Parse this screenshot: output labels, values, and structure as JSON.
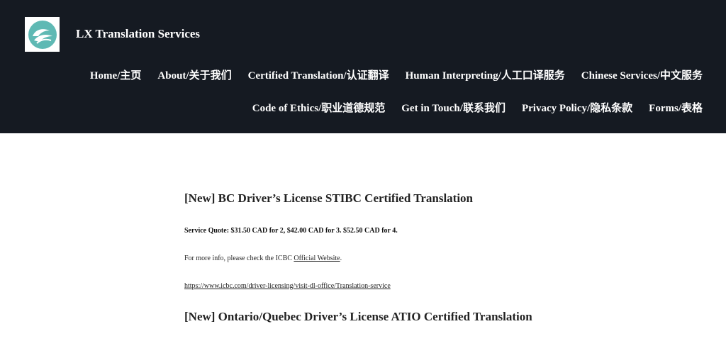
{
  "site": {
    "title": "LX Translation Services",
    "logo_icon": "wave-hands-icon",
    "colors": {
      "header_bg": "#151a22",
      "logo_teal": "#5fb9b4"
    }
  },
  "nav": {
    "row1": [
      {
        "label": "Home/主页"
      },
      {
        "label": "About/关于我们"
      },
      {
        "label": "Certified Translation/认证翻译"
      },
      {
        "label": "Human Interpreting/人工口译服务"
      },
      {
        "label": "Chinese Services/中文服务"
      }
    ],
    "row2": [
      {
        "label": "Code of Ethics/职业道德规范"
      },
      {
        "label": "Get in Touch/联系我们"
      },
      {
        "label": "Privacy Policy/隐私条款"
      },
      {
        "label": "Forms/表格"
      }
    ]
  },
  "content": {
    "heading1": "[New] BC Driver’s License STIBC Certified Translation",
    "quote": "Service Quote: $31.50 CAD for 2, $42.00 CAD for 3. $52.50 CAD for 4.",
    "info_prefix": "For more info, please check the ICBC ",
    "info_link": "Official Website",
    "info_suffix": ".",
    "url": "https://www.icbc.com/driver-licensing/visit-dl-office/Translation-service",
    "heading2": "[New] Ontario/Quebec Driver’s License ATIO Certified Translation"
  }
}
